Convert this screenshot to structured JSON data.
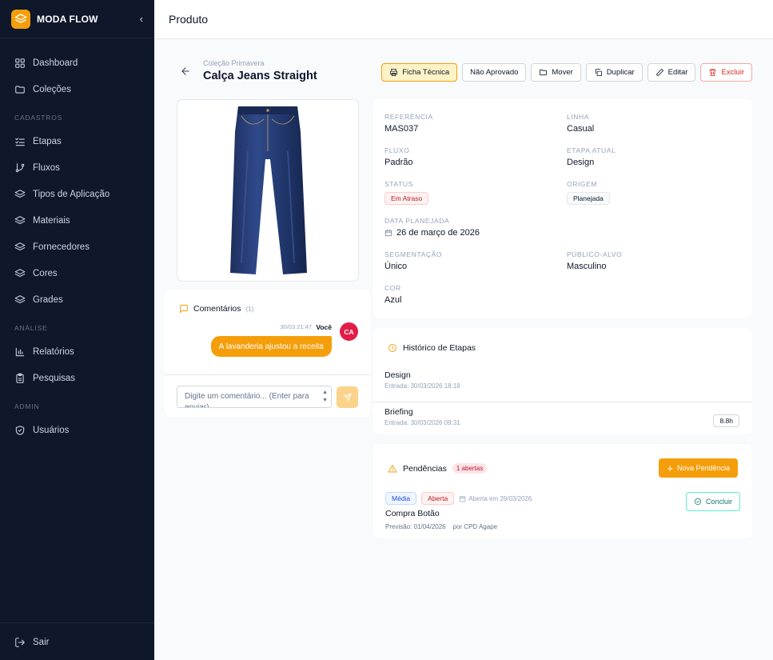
{
  "app": {
    "name": "MODA FLOW"
  },
  "colors": {
    "accent": "#f59e0b",
    "sidebar": "#0f172a",
    "danger": "#dc2626"
  },
  "sidebar": {
    "top_items": [
      {
        "label": "Dashboard",
        "icon": "layout-grid-icon"
      },
      {
        "label": "Coleções",
        "icon": "folder-open-icon"
      }
    ],
    "sections": [
      {
        "title": "CADASTROS",
        "items": [
          {
            "label": "Etapas",
            "icon": "list-checks-icon"
          },
          {
            "label": "Fluxos",
            "icon": "git-branch-icon"
          },
          {
            "label": "Tipos de Aplicação",
            "icon": "layers-icon"
          },
          {
            "label": "Materiais",
            "icon": "layers-icon"
          },
          {
            "label": "Fornecedores",
            "icon": "layers-icon"
          },
          {
            "label": "Cores",
            "icon": "layers-icon"
          },
          {
            "label": "Grades",
            "icon": "layers-icon"
          }
        ]
      },
      {
        "title": "ANÁLISE",
        "items": [
          {
            "label": "Relatórios",
            "icon": "bar-chart-icon"
          },
          {
            "label": "Pesquisas",
            "icon": "clipboard-icon"
          }
        ]
      },
      {
        "title": "ADMIN",
        "items": [
          {
            "label": "Usuários",
            "icon": "shield-icon"
          }
        ]
      }
    ],
    "logout": "Sair"
  },
  "header": {
    "title": "Produto"
  },
  "product": {
    "collection": "Coleção Primavera",
    "title": "Calça Jeans Straight"
  },
  "actions": {
    "tech_sheet": "Ficha Técnica",
    "not_approved": "Não Aprovado",
    "move": "Mover",
    "duplicate": "Duplicar",
    "edit": "Editar",
    "delete": "Excluir"
  },
  "details": {
    "referencia": {
      "label": "REFERÊNCIA",
      "value": "MAS037"
    },
    "linha": {
      "label": "LINHA",
      "value": "Casual"
    },
    "fluxo": {
      "label": "FLUXO",
      "value": "Padrão"
    },
    "etapa_atual": {
      "label": "ETAPA ATUAL",
      "value": "Design"
    },
    "status": {
      "label": "STATUS",
      "value": "Em Atraso"
    },
    "origem": {
      "label": "ORIGEM",
      "value": "Planejada"
    },
    "data_planejada": {
      "label": "DATA PLANEJADA",
      "value": "26 de março de 2026"
    },
    "segmentacao": {
      "label": "SEGMENTAÇÃO",
      "value": "Único"
    },
    "publico_alvo": {
      "label": "PÚBLICO-ALVO",
      "value": "Masculino"
    },
    "cor": {
      "label": "COR",
      "value": "Azul"
    }
  },
  "comments": {
    "title": "Comentários",
    "count": "(1)",
    "items": [
      {
        "author": "Você",
        "time": "30/03 21:47",
        "initials": "CA",
        "text": "A lavanderia ajustou a receita"
      }
    ],
    "input_placeholder": "Digite um comentário... (Enter para enviar)"
  },
  "history": {
    "title": "Histórico de Etapas",
    "rows": [
      {
        "name": "Design",
        "entry": "Entrada: 30/03/2026 18:18",
        "duration": ""
      },
      {
        "name": "Briefing",
        "entry": "Entrada: 30/03/2026 09:31",
        "duration": "8.8h"
      }
    ]
  },
  "pendencias": {
    "title": "Pendências",
    "open_count": "1 abertas",
    "new_button": "Nova Pendência",
    "items": [
      {
        "priority": "Média",
        "state": "Aberta",
        "opened": "Aberta em 29/03/2026",
        "title": "Compra Botão",
        "forecast": "Previsão: 01/04/2026",
        "by": "por CPD Agape",
        "action": "Concluir"
      }
    ]
  }
}
